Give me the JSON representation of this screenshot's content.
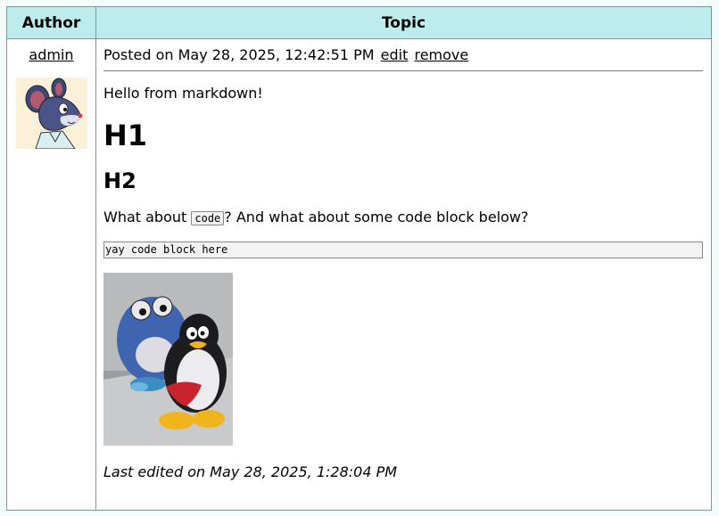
{
  "header": {
    "author_col": "Author",
    "topic_col": "Topic"
  },
  "author": {
    "name": "admin",
    "avatar_icon": "mouse-avatar-icon"
  },
  "post": {
    "posted_on": "Posted on May 28, 2025, 12:42:51 PM",
    "edit_label": "edit",
    "remove_label": "remove",
    "paragraph1": "Hello from markdown!",
    "h1": "H1",
    "h2": "H2",
    "para2_before": "What about ",
    "inline_code": "code",
    "para2_after": "? And what about some code block below?",
    "code_block": "yay code block here",
    "photo_icon": "plush-toys-photo",
    "last_edited": "Last edited on May 28, 2025, 1:28:04 PM"
  },
  "colors": {
    "header_bg": "#bdeced",
    "border": "#7a9a9a",
    "page_bg": "#f4fbfb"
  }
}
